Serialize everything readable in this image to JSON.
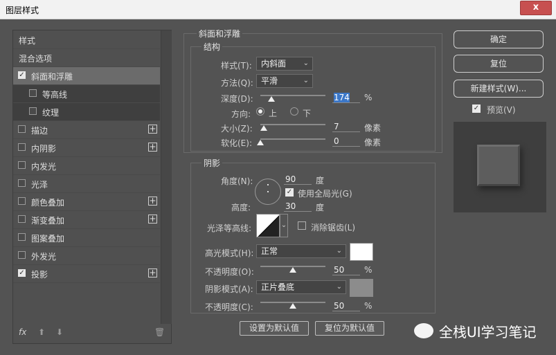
{
  "window": {
    "title": "图层样式",
    "close_glyph": "x"
  },
  "left_panel": {
    "items": [
      {
        "label": "样式",
        "checkbox": false,
        "checked": false,
        "plus": false
      },
      {
        "label": "混合选项",
        "checkbox": false,
        "checked": false,
        "plus": false
      },
      {
        "label": "斜面和浮雕",
        "checkbox": true,
        "checked": true,
        "plus": false
      },
      {
        "label": "等高线",
        "checkbox": true,
        "checked": false,
        "plus": false
      },
      {
        "label": "纹理",
        "checkbox": true,
        "checked": false,
        "plus": false
      },
      {
        "label": "描边",
        "checkbox": true,
        "checked": false,
        "plus": true
      },
      {
        "label": "内阴影",
        "checkbox": true,
        "checked": false,
        "plus": true
      },
      {
        "label": "内发光",
        "checkbox": true,
        "checked": false,
        "plus": false
      },
      {
        "label": "光泽",
        "checkbox": true,
        "checked": false,
        "plus": false
      },
      {
        "label": "颜色叠加",
        "checkbox": true,
        "checked": false,
        "plus": true
      },
      {
        "label": "渐变叠加",
        "checkbox": true,
        "checked": false,
        "plus": true
      },
      {
        "label": "图案叠加",
        "checkbox": true,
        "checked": false,
        "plus": false
      },
      {
        "label": "外发光",
        "checkbox": true,
        "checked": false,
        "plus": false
      },
      {
        "label": "投影",
        "checkbox": true,
        "checked": true,
        "plus": true
      }
    ],
    "bottom": {
      "fx": "fx",
      "up": "⬆",
      "down": "⬇",
      "trash": "🗑"
    }
  },
  "bevel": {
    "section_title": "斜面和浮雕",
    "structure_title": "结构",
    "style_label": "样式(T):",
    "style_value": "内斜面",
    "technique_label": "方法(Q):",
    "technique_value": "平滑",
    "depth_label": "深度(D):",
    "depth_value": "174",
    "depth_unit": "%",
    "depth_level": 0.17,
    "direction_label": "方向:",
    "dir_up": "上",
    "dir_down": "下",
    "size_label": "大小(Z):",
    "size_value": "7",
    "size_unit": "像素",
    "size_level": 0.05,
    "soften_label": "软化(E):",
    "soften_value": "0",
    "soften_unit": "像素",
    "soften_level": 0.0
  },
  "shading": {
    "title": "阴影",
    "angle_label": "角度(N):",
    "angle_value": "90",
    "angle_unit": "度",
    "global_light_label": "使用全局光(G)",
    "altitude_label": "高度:",
    "altitude_value": "30",
    "altitude_unit": "度",
    "gloss_label": "光泽等高线:",
    "antialias_label": "消除锯齿(L)",
    "highlight_label": "高光模式(H):",
    "highlight_value": "正常",
    "highlight_color": "#ffffff",
    "hl_opacity_label": "不透明度(O):",
    "hl_opacity_value": "50",
    "hl_opacity_unit": "%",
    "hl_opacity_level": 0.5,
    "shadow_label": "阴影模式(A):",
    "shadow_value": "正片叠底",
    "shadow_color": "#8c8c8c",
    "sh_opacity_label": "不透明度(C):",
    "sh_opacity_value": "50",
    "sh_opacity_unit": "%",
    "sh_opacity_level": 0.5
  },
  "footer": {
    "set_default": "设置为默认值",
    "reset_default": "复位为默认值"
  },
  "right": {
    "ok": "确定",
    "reset": "复位",
    "new_style": "新建样式(W)...",
    "preview_label": "预览(V)"
  },
  "watermark": {
    "text": "全栈UI学习笔记"
  }
}
